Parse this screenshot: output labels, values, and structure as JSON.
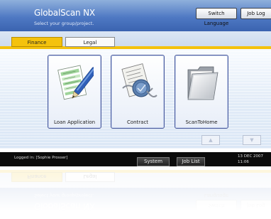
{
  "header": {
    "title": "GlobalScan NX",
    "subtitle": "Select your group/project.",
    "switch_language": "Switch Language",
    "job_log": "Job Log"
  },
  "tabs": [
    {
      "label": "Finance",
      "active": true
    },
    {
      "label": "Legal",
      "active": false
    }
  ],
  "cards": [
    {
      "label": "Loan Application",
      "icon": "loan-form-pen-icon"
    },
    {
      "label": "Contract",
      "icon": "contract-seal-icon"
    },
    {
      "label": "ScanToHome",
      "icon": "folder-icon"
    }
  ],
  "nav": {
    "up": "▲",
    "down": "▼"
  },
  "status": {
    "logged_in": "Logged in: [Sophie Prosser]",
    "system_status": "System Status",
    "job_list": "Job List",
    "date": "13 DEC 2007",
    "time": "11:06"
  },
  "colors": {
    "accent": "#f4c20d",
    "header": "#4f79c3",
    "statusbar": "#0b0b0b"
  }
}
